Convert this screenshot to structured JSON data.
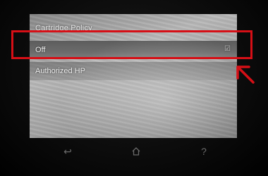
{
  "screen": {
    "title": "Cartridge Policy",
    "options": [
      {
        "label": "Off",
        "selected": true
      },
      {
        "label": "Authorized HP",
        "selected": false
      }
    ]
  },
  "navbar": {
    "items": [
      {
        "icon": "back-icon",
        "glyph": "↩"
      },
      {
        "icon": "home-icon",
        "glyph": "⌂"
      },
      {
        "icon": "help-icon",
        "glyph": "?"
      }
    ]
  },
  "annotation": {
    "highlight_color": "#d60f16"
  }
}
